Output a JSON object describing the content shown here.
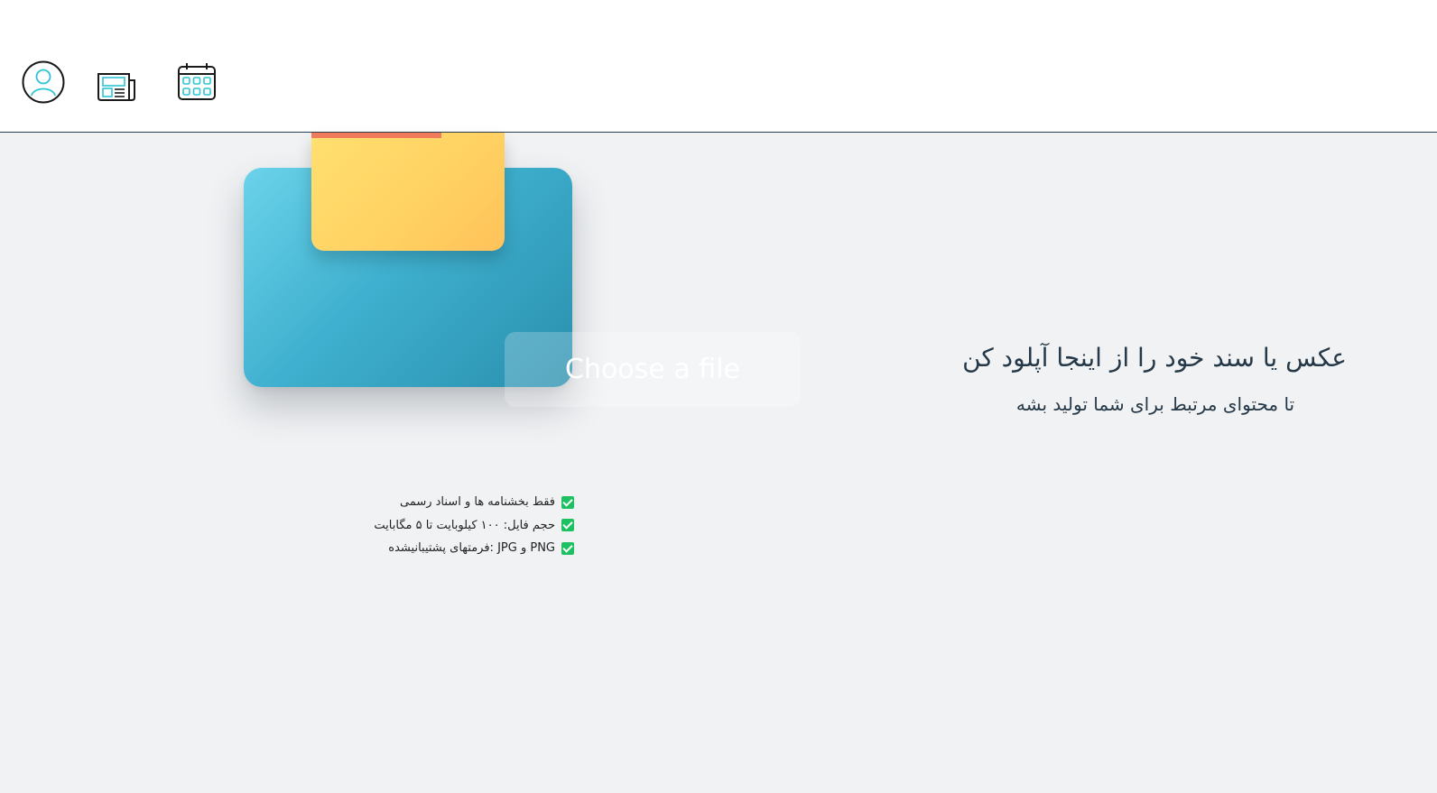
{
  "nav": {
    "icons": [
      "user-profile-icon",
      "news-icon",
      "calendar-icon"
    ],
    "accent_color": "#2ec4d4"
  },
  "upload": {
    "button_label": "Choose a file",
    "card_color": "#3fb0cf",
    "folder_color": "#ffd263",
    "folder_tab_color": "#ef7a5c"
  },
  "rules": [
    {
      "text": "فقط بخشنامه ها و اسناد رسمی",
      "icon": "check-icon"
    },
    {
      "text": "حجم فایل: ۱۰۰ کیلوبایت تا ۵ مگابایت",
      "icon": "check-icon"
    },
    {
      "text": "PNG و JPG :فرمتهای پشتیبانیشده",
      "icon": "check-icon"
    }
  ],
  "check_color": "#1ec162",
  "headline": "عکس یا سند خود را از اینجا آپلود کن",
  "subheadline": "تا محتوای مرتبط برای شما تولید بشه"
}
